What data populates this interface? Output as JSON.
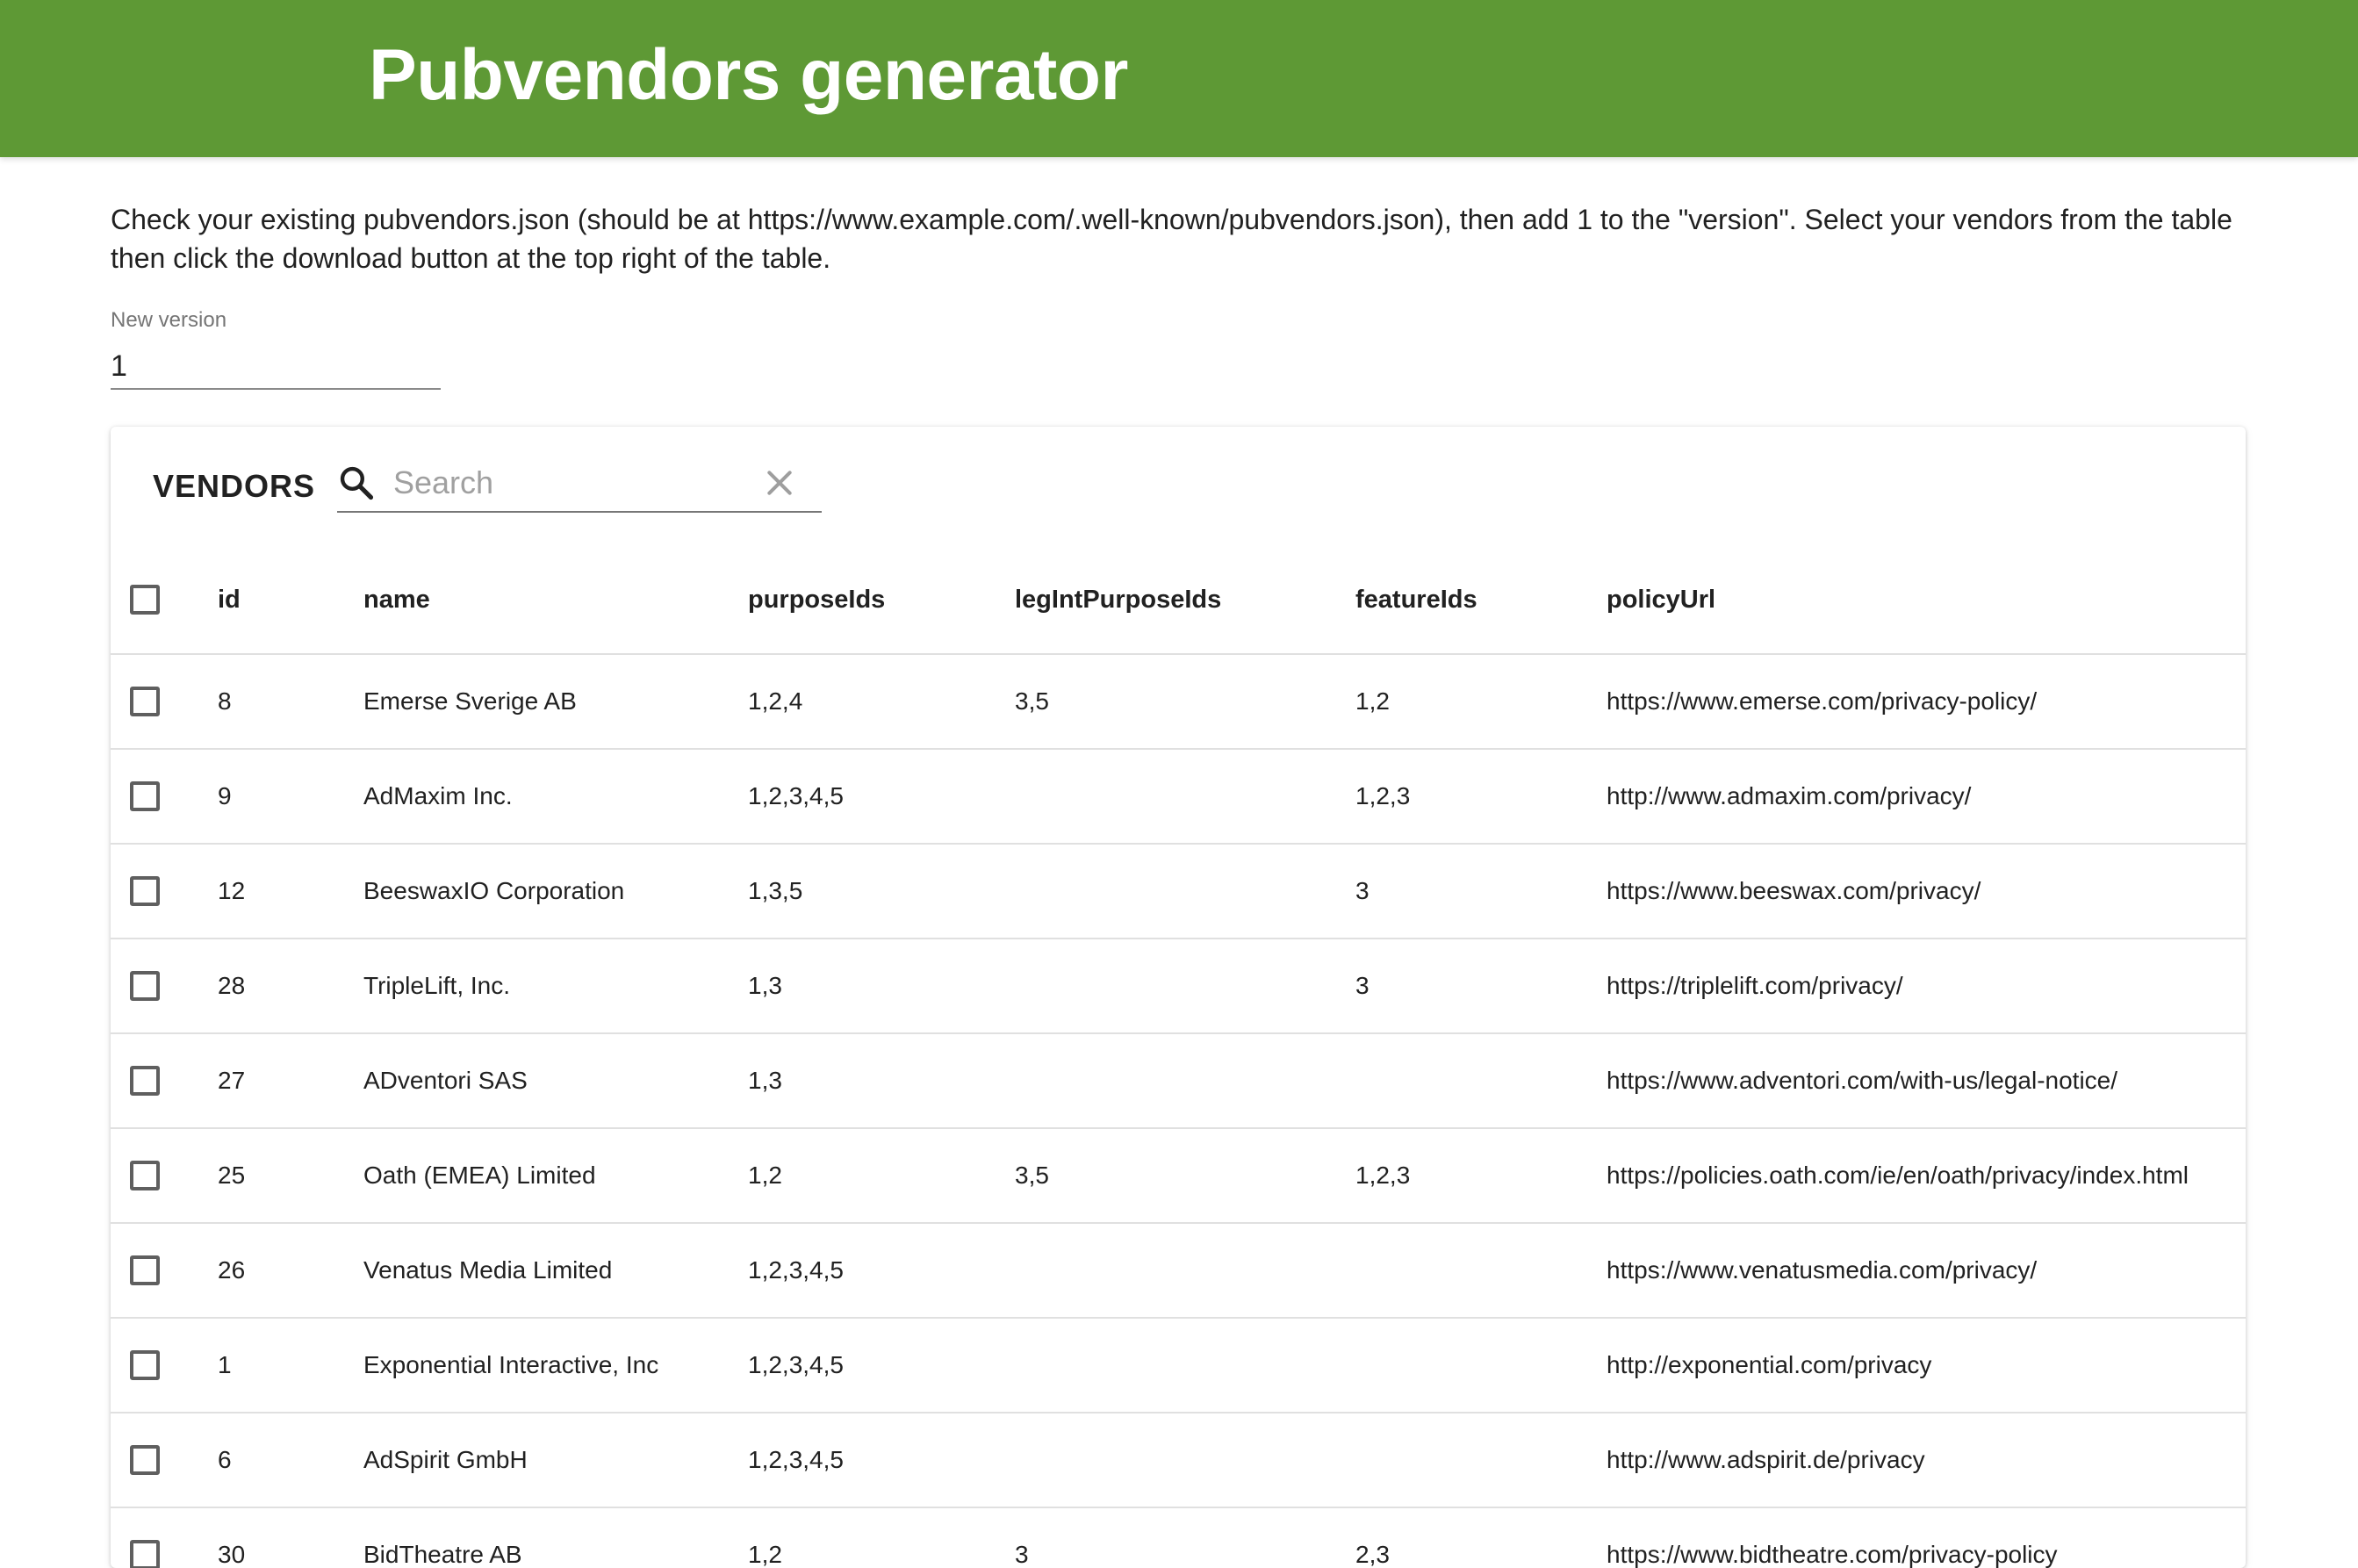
{
  "header": {
    "title": "Pubvendors generator"
  },
  "intro": {
    "text": "Check your existing pubvendors.json (should be at https://www.example.com/.well-known/pubvendors.json), then add 1 to the \"version\". Select your vendors from the table then click the download button at the top right of the table."
  },
  "version_field": {
    "label": "New version",
    "value": "1"
  },
  "vendors_table": {
    "title": "VENDORS",
    "search_placeholder": "Search",
    "columns": [
      "id",
      "name",
      "purposeIds",
      "legIntPurposeIds",
      "featureIds",
      "policyUrl"
    ],
    "rows": [
      {
        "id": "8",
        "name": "Emerse Sverige AB",
        "purposeIds": "1,2,4",
        "legIntPurposeIds": "3,5",
        "featureIds": "1,2",
        "policyUrl": "https://www.emerse.com/privacy-policy/"
      },
      {
        "id": "9",
        "name": "AdMaxim Inc.",
        "purposeIds": "1,2,3,4,5",
        "legIntPurposeIds": "",
        "featureIds": "1,2,3",
        "policyUrl": "http://www.admaxim.com/privacy/"
      },
      {
        "id": "12",
        "name": "BeeswaxIO Corporation",
        "purposeIds": "1,3,5",
        "legIntPurposeIds": "",
        "featureIds": "3",
        "policyUrl": "https://www.beeswax.com/privacy/"
      },
      {
        "id": "28",
        "name": "TripleLift, Inc.",
        "purposeIds": "1,3",
        "legIntPurposeIds": "",
        "featureIds": "3",
        "policyUrl": "https://triplelift.com/privacy/"
      },
      {
        "id": "27",
        "name": "ADventori SAS",
        "purposeIds": "1,3",
        "legIntPurposeIds": "",
        "featureIds": "",
        "policyUrl": "https://www.adventori.com/with-us/legal-notice/"
      },
      {
        "id": "25",
        "name": "Oath (EMEA) Limited",
        "purposeIds": "1,2",
        "legIntPurposeIds": "3,5",
        "featureIds": "1,2,3",
        "policyUrl": "https://policies.oath.com/ie/en/oath/privacy/index.html"
      },
      {
        "id": "26",
        "name": "Venatus Media Limited",
        "purposeIds": "1,2,3,4,5",
        "legIntPurposeIds": "",
        "featureIds": "",
        "policyUrl": "https://www.venatusmedia.com/privacy/"
      },
      {
        "id": "1",
        "name": "Exponential Interactive, Inc",
        "purposeIds": "1,2,3,4,5",
        "legIntPurposeIds": "",
        "featureIds": "",
        "policyUrl": "http://exponential.com/privacy"
      },
      {
        "id": "6",
        "name": "AdSpirit GmbH",
        "purposeIds": "1,2,3,4,5",
        "legIntPurposeIds": "",
        "featureIds": "",
        "policyUrl": "http://www.adspirit.de/privacy"
      },
      {
        "id": "30",
        "name": "BidTheatre AB",
        "purposeIds": "1,2",
        "legIntPurposeIds": "3",
        "featureIds": "2,3",
        "policyUrl": "https://www.bidtheatre.com/privacy-policy"
      }
    ]
  },
  "icons": {
    "search": "search-icon",
    "clear": "close-icon",
    "checkbox": "checkbox-unchecked"
  },
  "colors": {
    "appbar": "#5e9935",
    "appbar_text": "#ffffff",
    "text": "#212121",
    "muted": "#757575",
    "divider": "#e0e0e0"
  }
}
